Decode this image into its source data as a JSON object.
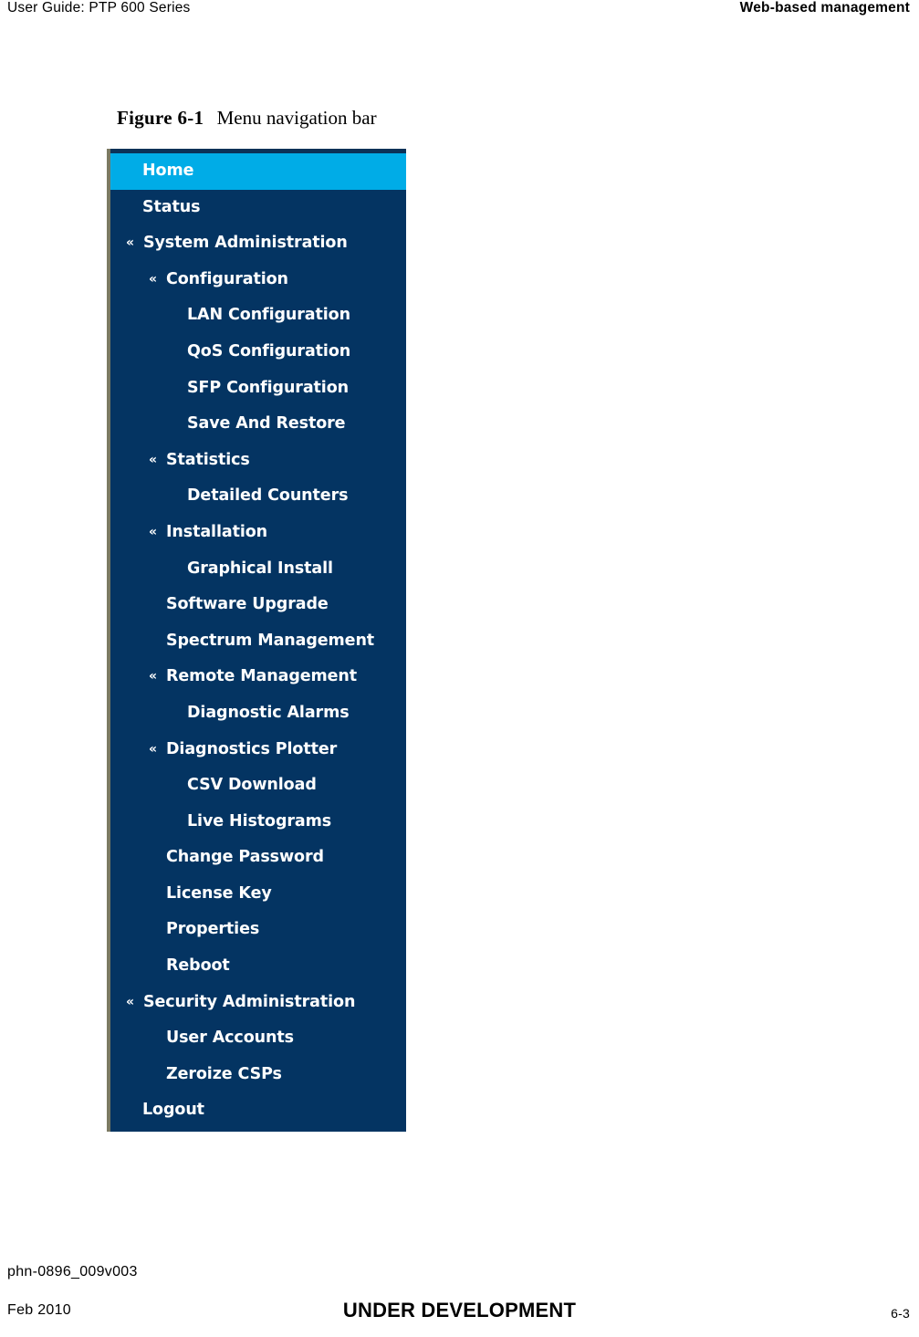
{
  "header": {
    "left": "User Guide: PTP 600 Series",
    "right": "Web-based management"
  },
  "figure": {
    "number": "Figure 6-1",
    "title": "Menu navigation bar"
  },
  "nav_menu": {
    "selected": "Home",
    "colors": {
      "background": "#043462",
      "selected_background": "#00ace7",
      "text": "#ffffff",
      "left_border": "#7b7a63",
      "top_strip": "#0b3258"
    },
    "expand_marker": "«",
    "items": [
      {
        "label": "Home",
        "level": 0,
        "marker": false,
        "selected": true
      },
      {
        "label": "Status",
        "level": 0,
        "marker": false,
        "selected": false
      },
      {
        "label": "System Administration",
        "level": 1,
        "marker": true,
        "selected": false
      },
      {
        "label": "Configuration",
        "level": 2,
        "marker": true,
        "selected": false
      },
      {
        "label": "LAN Configuration",
        "level": 3,
        "marker": false,
        "selected": false
      },
      {
        "label": "QoS Configuration",
        "level": 3,
        "marker": false,
        "selected": false
      },
      {
        "label": "SFP Configuration",
        "level": 3,
        "marker": false,
        "selected": false
      },
      {
        "label": "Save And Restore",
        "level": 3,
        "marker": false,
        "selected": false
      },
      {
        "label": "Statistics",
        "level": 2,
        "marker": true,
        "selected": false
      },
      {
        "label": "Detailed Counters",
        "level": 3,
        "marker": false,
        "selected": false
      },
      {
        "label": "Installation",
        "level": 2,
        "marker": true,
        "selected": false
      },
      {
        "label": "Graphical Install",
        "level": 3,
        "marker": false,
        "selected": false
      },
      {
        "label": "Software Upgrade",
        "level": 2,
        "marker": false,
        "selected": false
      },
      {
        "label": "Spectrum Management",
        "level": 2,
        "marker": false,
        "selected": false
      },
      {
        "label": "Remote Management",
        "level": 2,
        "marker": true,
        "selected": false
      },
      {
        "label": "Diagnostic Alarms",
        "level": 3,
        "marker": false,
        "selected": false
      },
      {
        "label": "Diagnostics Plotter",
        "level": 2,
        "marker": true,
        "selected": false
      },
      {
        "label": "CSV Download",
        "level": 3,
        "marker": false,
        "selected": false
      },
      {
        "label": "Live Histograms",
        "level": 3,
        "marker": false,
        "selected": false
      },
      {
        "label": "Change Password",
        "level": 2,
        "marker": false,
        "selected": false
      },
      {
        "label": "License Key",
        "level": 2,
        "marker": false,
        "selected": false
      },
      {
        "label": "Properties",
        "level": 2,
        "marker": false,
        "selected": false
      },
      {
        "label": "Reboot",
        "level": 2,
        "marker": false,
        "selected": false
      },
      {
        "label": "Security Administration",
        "level": 1,
        "marker": true,
        "selected": false
      },
      {
        "label": "User Accounts",
        "level": 2,
        "marker": false,
        "selected": false
      },
      {
        "label": "Zeroize CSPs",
        "level": 2,
        "marker": false,
        "selected": false
      },
      {
        "label": "Logout",
        "level": 0,
        "marker": false,
        "selected": false
      }
    ]
  },
  "footer": {
    "doc_code": "phn-0896_009v003",
    "date": "Feb 2010",
    "status": "UNDER DEVELOPMENT",
    "page_number": "6-3"
  }
}
